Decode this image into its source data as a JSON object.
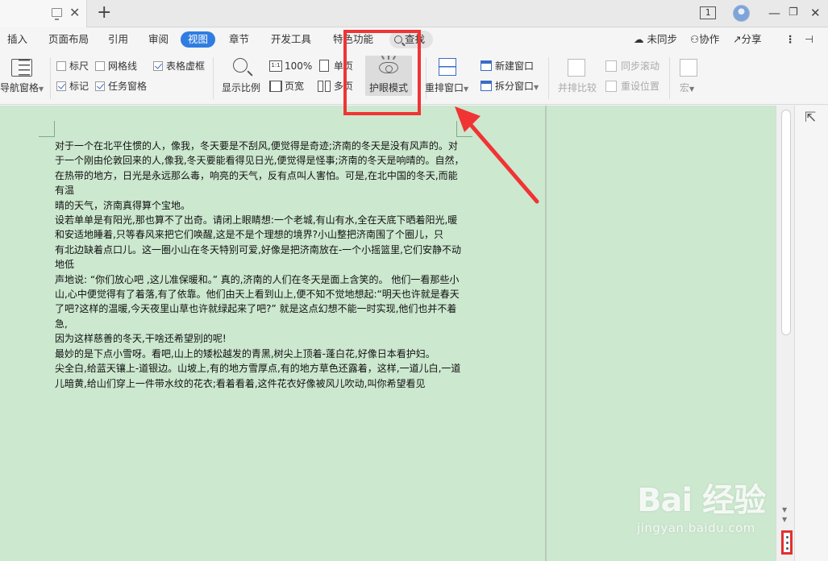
{
  "menu": {
    "items": [
      "插入",
      "页面布局",
      "引用",
      "审阅",
      "视图",
      "章节",
      "开发工具",
      "特色功能"
    ],
    "search": "查找",
    "sync": "未同步",
    "collab": "协作",
    "share": "分享"
  },
  "window": {
    "page_count": "1"
  },
  "ribbon": {
    "nav_pane": "导航窗格",
    "ruler": "标尺",
    "gridlines": "网格线",
    "table_gridlines": "表格虚框",
    "markers": "标记",
    "task_pane": "任务窗格",
    "zoom": "显示比例",
    "zoom_100": "100%",
    "page_width": "页宽",
    "single_page": "单页",
    "multi_page": "多页",
    "eye_mode": "护眼模式",
    "rearrange": "重排窗口",
    "new_window": "新建窗口",
    "split_window": "拆分窗口",
    "side_by_side": "并排比较",
    "sync_scroll": "同步滚动",
    "reset_position": "重设位置",
    "macro": "宏"
  },
  "document": {
    "lines": [
      "对于一个在北平住惯的人，像我，冬天要是不刮风,便觉得是奇迹;济南的冬天是没有风声的。对",
      "于一个刚由伦敦回来的人,像我,冬天要能看得见日光,便觉得是怪事;济南的冬天是响晴的。自然，",
      "在热带的地方，日光是永远那么毒，响亮的天气，反有点叫人害怕。可是,在北中国的冬天,而能有温",
      "晴的天气，济南真得算个宝地。",
      "设若单单是有阳光,那也算不了出奇。请闭上眼睛想:一个老城,有山有水,全在天底下晒着阳光,暖和安适地睡着,只等春风来把它们唤醒,这是不是个理想的境界?小山整把济南围了个圈儿，只",
      "有北边缺着点口儿。这一圈小山在冬天特别可爱,好像是把济南放在-一个小摇篮里,它们安静不动地低",
      "声地说: “你们放心吧 ,这儿准保暖和。” 真的,济南的人们在冬天是面上含笑的。 他们一看那些小",
      "山,心中便觉得有了着落,有了依靠。他们由天上看到山上,便不知不觉地想起:“明天也许就是春天",
      "了吧?这样的温暖,今天夜里山草也许就绿起来了吧?” 就是这点幻想不能一时实现,他们也并不着急,",
      "因为这样慈善的冬天,干啥还希望别的呢!",
      "最妙的是下点小雪呀。看吧,山上的矮松越发的青黑,树尖上顶着-蓬白花,好像日本看护妇。",
      "尖全白,给蓝天镶上-道银边。山坡上,有的地方雪厚点,有的地方草色还露着，这样,一道儿白,一道儿暗黄,给山们穿上一件带水纹的花衣;看着看着,这件花衣好像被风儿吹动,叫你希望看见"
    ]
  },
  "watermark": {
    "logo": "Bai 经验",
    "url": "jingyan.baidu.com"
  },
  "colors": {
    "eye_green": "#cce8cf",
    "accent": "#2f7de1",
    "annotation_red": "#f03434"
  }
}
